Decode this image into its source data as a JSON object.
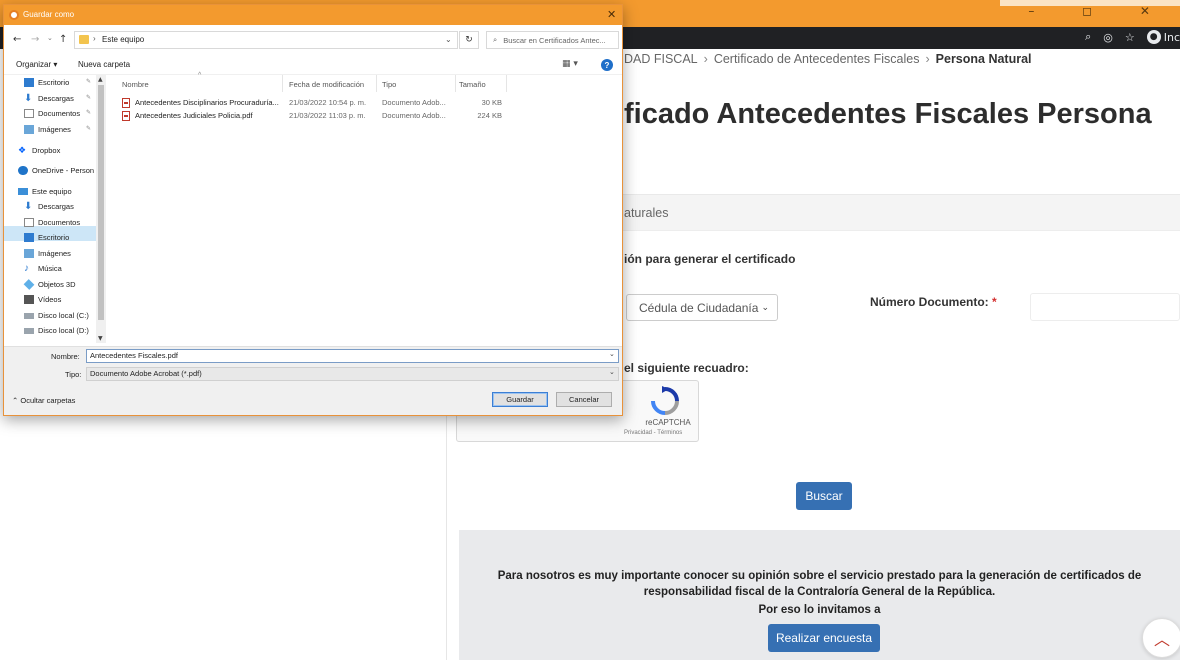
{
  "browser": {
    "window_controls": "–  ◻  ✕",
    "incognito_label": "Inc"
  },
  "page": {
    "breadcrumb": [
      "DAD FISCAL",
      "Certificado de Antecedentes Fiscales",
      "Persona Natural"
    ],
    "title": "ficado Antecedentes Fiscales Persona",
    "section_tab": "aturales",
    "option_heading": "ión para generar el certificado",
    "doc_type_value": "Cédula de Ciudadanía",
    "doc_number_label": "Número Documento:",
    "required_mark": "*",
    "captcha_instruction": "el siguiente recuadro:",
    "recaptcha_label": "reCAPTCHA",
    "recaptcha_links": "Privacidad - Términos",
    "search_button": "Buscar",
    "survey_text": "Para nosotros es muy importante conocer su opinión sobre el servicio prestado para la generación de certificados de responsabilidad fiscal de la Contraloría General de la República.",
    "survey_sub": "Por eso lo invitamos a",
    "survey_button": "Realizar encuesta",
    "scroll_top_icon": "︿"
  },
  "dialog": {
    "title": "Guardar como",
    "close": "✕",
    "nav": {
      "back": "←",
      "forward": "→",
      "recent": "⌄",
      "up": "↑"
    },
    "address": "Este equipo",
    "address_chevron": "›",
    "address_dropdown": "⌄",
    "refresh": "↻",
    "search_placeholder": "Buscar en Certificados Antec...",
    "search_icon": "⌕",
    "organize": "Organizar ▾",
    "new_folder": "Nueva carpeta",
    "view_icon": "▦ ▾",
    "help_icon": "?",
    "nav_items": [
      {
        "label": "Escritorio",
        "icon": "desktop-icon"
      },
      {
        "label": "Descargas",
        "icon": "download-icon"
      },
      {
        "label": "Documentos",
        "icon": "documents-icon"
      },
      {
        "label": "Imágenes",
        "icon": "pictures-icon"
      },
      {
        "label": "Dropbox",
        "icon": "dropbox-icon"
      },
      {
        "label": "OneDrive - Person",
        "icon": "onedrive-icon"
      },
      {
        "label": "Este equipo",
        "icon": "computer-icon"
      },
      {
        "label": "Descargas",
        "icon": "download-icon"
      },
      {
        "label": "Documentos",
        "icon": "documents-icon"
      },
      {
        "label": "Escritorio",
        "icon": "desktop-icon"
      },
      {
        "label": "Imágenes",
        "icon": "pictures-icon"
      },
      {
        "label": "Música",
        "icon": "music-icon"
      },
      {
        "label": "Objetos 3D",
        "icon": "objects3d-icon"
      },
      {
        "label": "Vídeos",
        "icon": "videos-icon"
      },
      {
        "label": "Disco local (C:)",
        "icon": "disk-icon"
      },
      {
        "label": "Disco local (D:)",
        "icon": "disk-icon"
      }
    ],
    "pin_icon": "📌",
    "columns": [
      "Nombre",
      "Fecha de modificación",
      "Tipo",
      "Tamaño"
    ],
    "files": [
      {
        "name": "Antecedentes Disciplinarios Procuraduría...",
        "date": "21/03/2022 10:54 p. m.",
        "type": "Documento Adob...",
        "size": "30 KB"
      },
      {
        "name": "Antecedentes Judiciales Policia.pdf",
        "date": "21/03/2022 11:03 p. m.",
        "type": "Documento Adob...",
        "size": "224 KB"
      }
    ],
    "name_label": "Nombre:",
    "name_value": "Antecedentes Fiscales.pdf",
    "type_label": "Tipo:",
    "type_value": "Documento Adobe Acrobat (*.pdf)",
    "hide_folders": "Ocultar carpetas",
    "save_button": "Guardar",
    "cancel_button": "Cancelar"
  }
}
